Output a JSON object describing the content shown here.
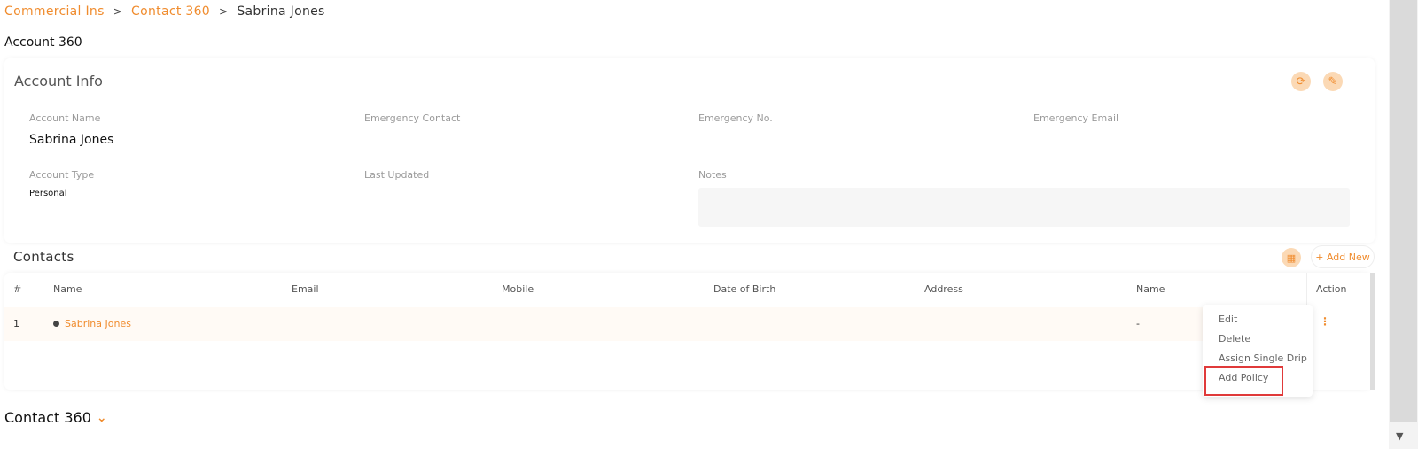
{
  "breadcrumb": {
    "items": [
      "Commercial Ins",
      "Contact 360",
      "Sabrina Jones"
    ],
    "separator": ">"
  },
  "page_title": "Account 360",
  "account_info": {
    "title": "Account Info",
    "fields": {
      "account_name": {
        "label": "Account Name",
        "value": "Sabrina Jones"
      },
      "emergency_contact": {
        "label": "Emergency Contact",
        "value": ""
      },
      "emergency_no": {
        "label": "Emergency No.",
        "value": ""
      },
      "emergency_email": {
        "label": "Emergency Email",
        "value": ""
      },
      "account_type": {
        "label": "Account Type",
        "value": "Personal"
      },
      "last_updated": {
        "label": "Last Updated",
        "value": ""
      },
      "notes": {
        "label": "Notes",
        "value": ""
      }
    }
  },
  "contacts": {
    "title": "Contacts",
    "add_new_label": "+ Add New",
    "columns": [
      "#",
      "Name",
      "Email",
      "Mobile",
      "Date of Birth",
      "Address",
      "Name",
      "Action"
    ],
    "rows": [
      {
        "index": "1",
        "name": "Sabrina Jones",
        "email": "",
        "mobile": "",
        "dob": "",
        "address": "",
        "name2": "-"
      }
    ]
  },
  "row_menu": {
    "items": [
      "Edit",
      "Delete",
      "Assign Single Drip",
      "Add Policy"
    ]
  },
  "contact360": {
    "title": "Contact 360"
  },
  "icons": {
    "refresh": "refresh-icon",
    "edit": "edit-icon",
    "grid": "grid-icon",
    "kebab": "kebab-icon",
    "chevron": "chevron-down-icon"
  },
  "colors": {
    "accent": "#f08c2e",
    "highlight": "#e03a3a"
  }
}
